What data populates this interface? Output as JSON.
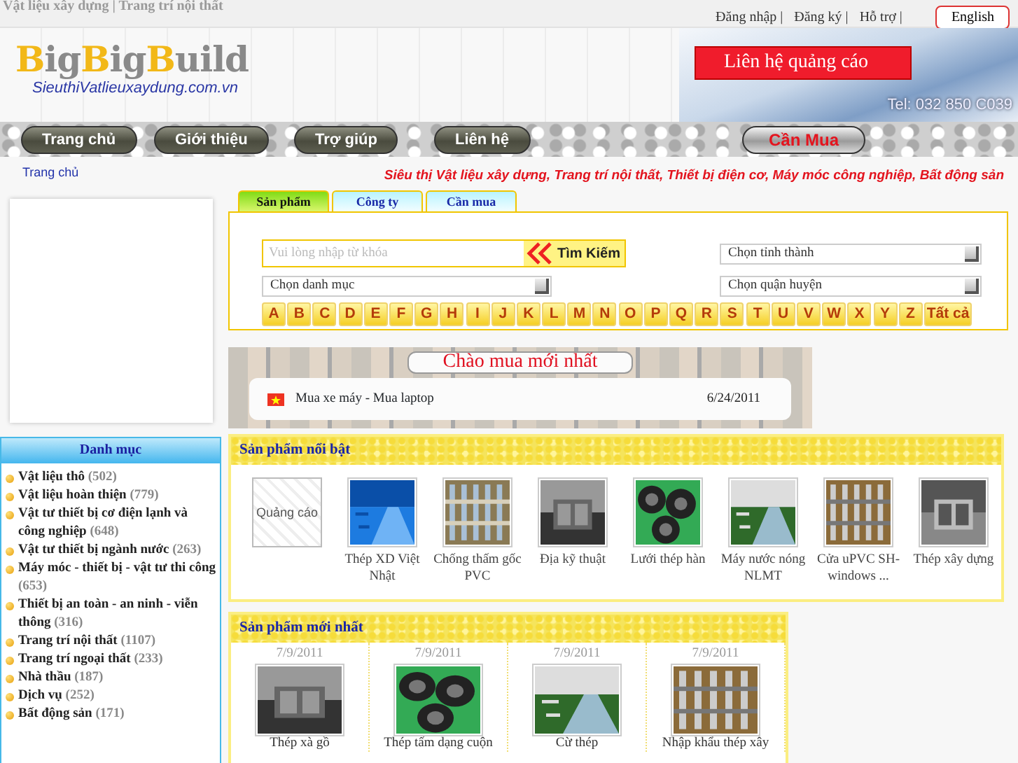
{
  "top_bar": {
    "faded_links": "Vật liệu xây dựng | Trang trí nội thất",
    "links": [
      "Đăng nhập |",
      "Đăng ký |",
      "Hỗ trợ |"
    ],
    "language_button": "English"
  },
  "header": {
    "logo": [
      {
        "text": "B",
        "color": "#f2b818"
      },
      {
        "text": "ig",
        "color": "#8a8a8a"
      },
      {
        "text": "B",
        "color": "#f2b818"
      },
      {
        "text": "ig",
        "color": "#8a8a8a"
      },
      {
        "text": "B",
        "color": "#f2b818"
      },
      {
        "text": "uild",
        "color": "#8a8a8a"
      }
    ],
    "domain": "SieuthiVatlieuxaydung.com.vn",
    "ad_button": "Liên hệ quảng cáo",
    "phone": "Tel: 032 850 C039"
  },
  "nav": [
    {
      "label": "Trang chủ",
      "kind": "main"
    },
    {
      "label": "Giới thiệu",
      "kind": "main"
    },
    {
      "label": "Trợ giúp",
      "kind": "main"
    },
    {
      "label": "Liên hệ",
      "kind": "main"
    },
    {
      "label": "Cần Mua",
      "kind": "buy"
    }
  ],
  "breadcrumb": "Trang chủ",
  "slogan": "Siêu thị Vật liệu xây dựng, Trang trí nội thất, Thiết bị điện cơ, Máy móc công nghiệp, Bất động sản",
  "search": {
    "tabs": [
      {
        "label": "Sản phẩm",
        "selected": true
      },
      {
        "label": "Công ty",
        "selected": false
      },
      {
        "label": "Cần mua",
        "selected": false
      }
    ],
    "placeholder": "Vui lòng nhập từ khóa",
    "button": "Tìm Kiếm",
    "province": "Chọn tỉnh thành",
    "category": "Chọn danh mục",
    "district": "Chọn quận huyện",
    "letters": [
      "A",
      "B",
      "C",
      "D",
      "E",
      "F",
      "G",
      "H",
      "I",
      "J",
      "K",
      "L",
      "M",
      "N",
      "O",
      "P",
      "Q",
      "R",
      "S",
      "T",
      "U",
      "V",
      "W",
      "X",
      "Y",
      "Z",
      "Tất cả"
    ]
  },
  "latest_buy": {
    "title": "Chào mua mới nhất",
    "items": [
      {
        "text": "Mua xe máy - Mua laptop",
        "date": "6/24/2011"
      }
    ]
  },
  "sidebar": {
    "title": "Danh mục",
    "items": [
      {
        "name": "Vật liệu thô",
        "count": "(502)"
      },
      {
        "name": "Vật liệu hoàn thiện",
        "count": "(779)"
      },
      {
        "name": "Vật tư thiết bị cơ điện lạnh và công nghiệp",
        "count": "(648)"
      },
      {
        "name": "Vật tư thiết bị ngành nước",
        "count": "(263)"
      },
      {
        "name": "Máy móc - thiết bị - vật tư thi công",
        "count": "(653)"
      },
      {
        "name": "Thiết bị an toàn - an ninh - viễn thông",
        "count": "(316)"
      },
      {
        "name": "Trang trí nội thất",
        "count": "(1107)"
      },
      {
        "name": "Trang trí ngoại thất",
        "count": "(233)"
      },
      {
        "name": "Nhà thầu",
        "count": "(187)"
      },
      {
        "name": "Dịch vụ",
        "count": "(252)"
      },
      {
        "name": "Bất động sản",
        "count": "(171)"
      }
    ]
  },
  "featured": {
    "title": "Sản phẩm nổi bật",
    "items": [
      {
        "kind": "ad",
        "ad_text": "Quảng cáo"
      },
      {
        "kind": "picture",
        "caption": "Thép XD Việt Nhật"
      },
      {
        "kind": "picture",
        "caption": "Chống thấm gốc PVC"
      },
      {
        "kind": "picture",
        "caption": "Địa kỹ thuật"
      },
      {
        "kind": "picture",
        "caption": "Lưới thép hàn"
      },
      {
        "kind": "picture",
        "caption": "Máy nước nóng NLMT"
      },
      {
        "kind": "picture",
        "caption": "Cửa uPVC SH-windows ..."
      },
      {
        "kind": "picture",
        "caption": "Thép xây dựng"
      }
    ]
  },
  "newest": {
    "title": "Sản phẩm mới nhất",
    "items": [
      {
        "date": "7/9/2011",
        "caption": "Thép xà gồ"
      },
      {
        "date": "7/9/2011",
        "caption": "Thép tấm dạng cuộn"
      },
      {
        "date": "7/9/2011",
        "caption": "Cừ thép"
      },
      {
        "date": "7/9/2011",
        "caption": "Nhập khẩu thép xây"
      }
    ]
  }
}
